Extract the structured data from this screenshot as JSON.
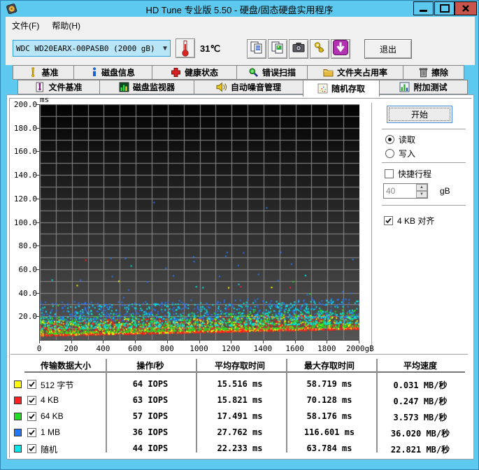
{
  "window": {
    "title": "HD Tune 专业版 5.50 - 硬盘/固态硬盘实用程序"
  },
  "menu": {
    "items": [
      "文件(F)",
      "帮助(H)"
    ]
  },
  "toolbar": {
    "drive": "WDC WD20EARX-00PASB0 (2000 gB)",
    "temperature": "31℃",
    "buttons": [
      {
        "id": "copy-text",
        "icon": "copy-text-icon"
      },
      {
        "id": "copy-image",
        "icon": "copy-image-icon"
      },
      {
        "id": "screenshot",
        "icon": "camera-icon"
      },
      {
        "id": "options",
        "icon": "gold-keys-icon"
      },
      {
        "id": "update",
        "icon": "download-arrow-icon"
      }
    ],
    "exit_label": "退出"
  },
  "tabs": {
    "row1": [
      {
        "id": "benchmark",
        "label": "基准",
        "icon": "exclaim-yellow-icon"
      },
      {
        "id": "disk-info",
        "label": "磁盘信息",
        "icon": "info-icon"
      },
      {
        "id": "health",
        "label": "健康状态",
        "icon": "health-cross-icon"
      },
      {
        "id": "error-scan",
        "label": "错误扫描",
        "icon": "magnifier-icon"
      },
      {
        "id": "folder-usage",
        "label": "文件夹占用率",
        "icon": "folder-icon"
      },
      {
        "id": "erase",
        "label": "擦除",
        "icon": "trash-icon"
      }
    ],
    "row2": [
      {
        "id": "file-benchmark",
        "label": "文件基准",
        "icon": "file-exclaim-icon"
      },
      {
        "id": "disk-monitor",
        "label": "磁盘监视器",
        "icon": "bar-monitor-icon"
      },
      {
        "id": "auto-noise",
        "label": "自动噪音管理",
        "icon": "speaker-icon"
      },
      {
        "id": "random-access",
        "label": "随机存取",
        "icon": "scatter-icon",
        "active": true
      },
      {
        "id": "extra-tests",
        "label": "附加测试",
        "icon": "extra-chart-icon"
      }
    ]
  },
  "controls": {
    "start": "开始",
    "read": "读取",
    "write": "写入",
    "read_selected": true,
    "short_stroke": "快捷行程",
    "short_stroke_checked": false,
    "short_stroke_value": "40",
    "short_stroke_unit": "gB",
    "align": "4 KB 对齐",
    "align_checked": true
  },
  "table": {
    "headers": [
      "传输数据大小",
      "操作/秒",
      "平均存取时间",
      "最大存取时间",
      "平均速度"
    ]
  },
  "chart_data": {
    "type": "scatter",
    "title": "随机存取 — 存取时间 vs 磁盘位置",
    "x_min": 0,
    "x_max": 2000,
    "x_unit": "gB",
    "x_tick_interval": 200,
    "x_grid_interval": 100,
    "y_min": 0,
    "y_max": 200,
    "y_unit": "ms",
    "y_tick_interval": 20,
    "y_grid_interval": 10,
    "x_ticks": [
      "0",
      "200",
      "400",
      "600",
      "800",
      "1000",
      "1200",
      "1400",
      "1600",
      "1800",
      "2000gB"
    ],
    "y_ticks": [
      "200.0",
      "180.0",
      "160.0",
      "140.0",
      "120.0",
      "100.0",
      "80.0",
      "60.0",
      "40.0",
      "20.0"
    ],
    "background_gradient": [
      "#030303",
      "#555555"
    ],
    "grid_color": "#8c8c8c",
    "series": [
      {
        "id": "512b",
        "label": "512 字节",
        "color": "#ffff00",
        "checked": true,
        "stats": {
          "iops": "64 IOPS",
          "avg": "15.516 ms",
          "max": "58.719 ms",
          "speed": "0.031 MB/秒"
        },
        "scatter": {
          "seed": 101,
          "count": 850,
          "base_start": 3.5,
          "base_end": 9.5,
          "band": 13,
          "skew": 2.1,
          "outlier_rate": 0.006,
          "outlier_max": 58
        }
      },
      {
        "id": "4kb",
        "label": "4 KB",
        "color": "#ff2020",
        "checked": true,
        "stats": {
          "iops": "63 IOPS",
          "avg": "15.821 ms",
          "max": "70.128 ms",
          "speed": "0.247 MB/秒"
        },
        "scatter": {
          "seed": 202,
          "count": 850,
          "base_start": 3.0,
          "base_end": 9.0,
          "band": 13,
          "skew": 2.1,
          "outlier_rate": 0.005,
          "outlier_max": 70
        }
      },
      {
        "id": "64kb",
        "label": "64 KB",
        "color": "#22dd22",
        "checked": true,
        "stats": {
          "iops": "57 IOPS",
          "avg": "17.491 ms",
          "max": "58.176 ms",
          "speed": "3.573 MB/秒"
        },
        "scatter": {
          "seed": 303,
          "count": 750,
          "base_start": 5.0,
          "base_end": 11.0,
          "band": 15,
          "skew": 2.0,
          "outlier_rate": 0.007,
          "outlier_max": 58
        }
      },
      {
        "id": "1mb",
        "label": "1 MB",
        "color": "#2277ff",
        "checked": true,
        "stats": {
          "iops": "36 IOPS",
          "avg": "27.762 ms",
          "max": "116.601 ms",
          "speed": "36.020 MB/秒"
        },
        "scatter": {
          "seed": 404,
          "count": 500,
          "base_start": 15.0,
          "base_end": 19.0,
          "band": 17,
          "skew": 1.5,
          "outlier_rate": 0.05,
          "outlier_max": 75
        },
        "extra_points": [
          [
            715,
            116.6
          ],
          [
            1420,
            112.0
          ]
        ]
      },
      {
        "id": "random",
        "label": "随机",
        "color": "#00e8e8",
        "checked": true,
        "stats": {
          "iops": "44 IOPS",
          "avg": "22.233 ms",
          "max": "63.784 ms",
          "speed": "22.821 MB/秒"
        },
        "scatter": {
          "seed": 505,
          "count": 650,
          "base_start": 9.0,
          "base_end": 14.0,
          "band": 20,
          "skew": 1.7,
          "outlier_rate": 0.015,
          "outlier_max": 63
        }
      }
    ]
  }
}
